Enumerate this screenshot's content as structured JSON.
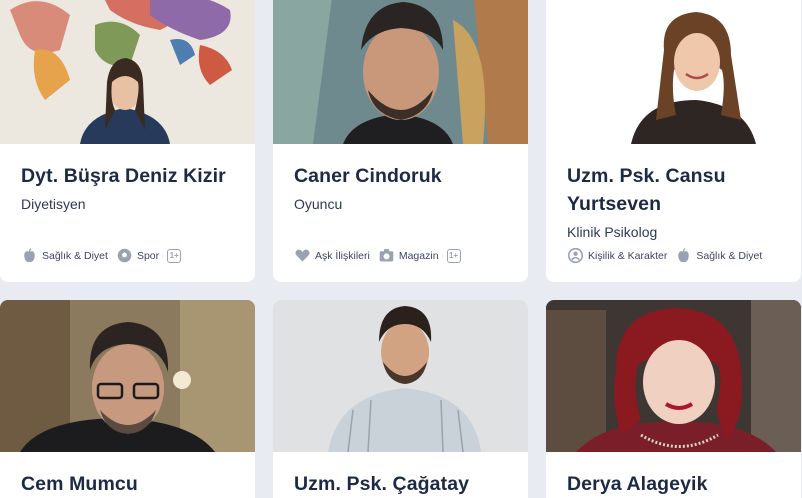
{
  "cards": [
    {
      "name": "Dyt. Büşra Deniz Kizir",
      "role": "Diyetisyen",
      "tags": [
        {
          "label": "Sağlık & Diyet",
          "icon": "apple-icon"
        },
        {
          "label": "Spor",
          "icon": "ball-icon"
        }
      ],
      "extra_badge": "1+"
    },
    {
      "name": "Caner Cindoruk",
      "role": "Oyuncu",
      "tags": [
        {
          "label": "Aşk İlişkileri",
          "icon": "heart-icon"
        },
        {
          "label": "Magazin",
          "icon": "camera-icon"
        }
      ],
      "extra_badge": "1+"
    },
    {
      "name": "Uzm. Psk. Cansu Yurtseven",
      "role": "Klinik Psikolog",
      "tags": [
        {
          "label": "Kişilik & Karakter",
          "icon": "person-icon"
        },
        {
          "label": "Sağlık & Diyet",
          "icon": "apple-icon"
        }
      ]
    },
    {
      "name": "Cem Mumcu"
    },
    {
      "name": "Uzm. Psk. Çağatay"
    },
    {
      "name": "Derya Alageyik"
    }
  ],
  "colors": {
    "background": "#e9ebf3",
    "card": "#ffffff",
    "name": "#1d2a44",
    "text": "#2c3a55",
    "icon": "#9aa2b1"
  }
}
